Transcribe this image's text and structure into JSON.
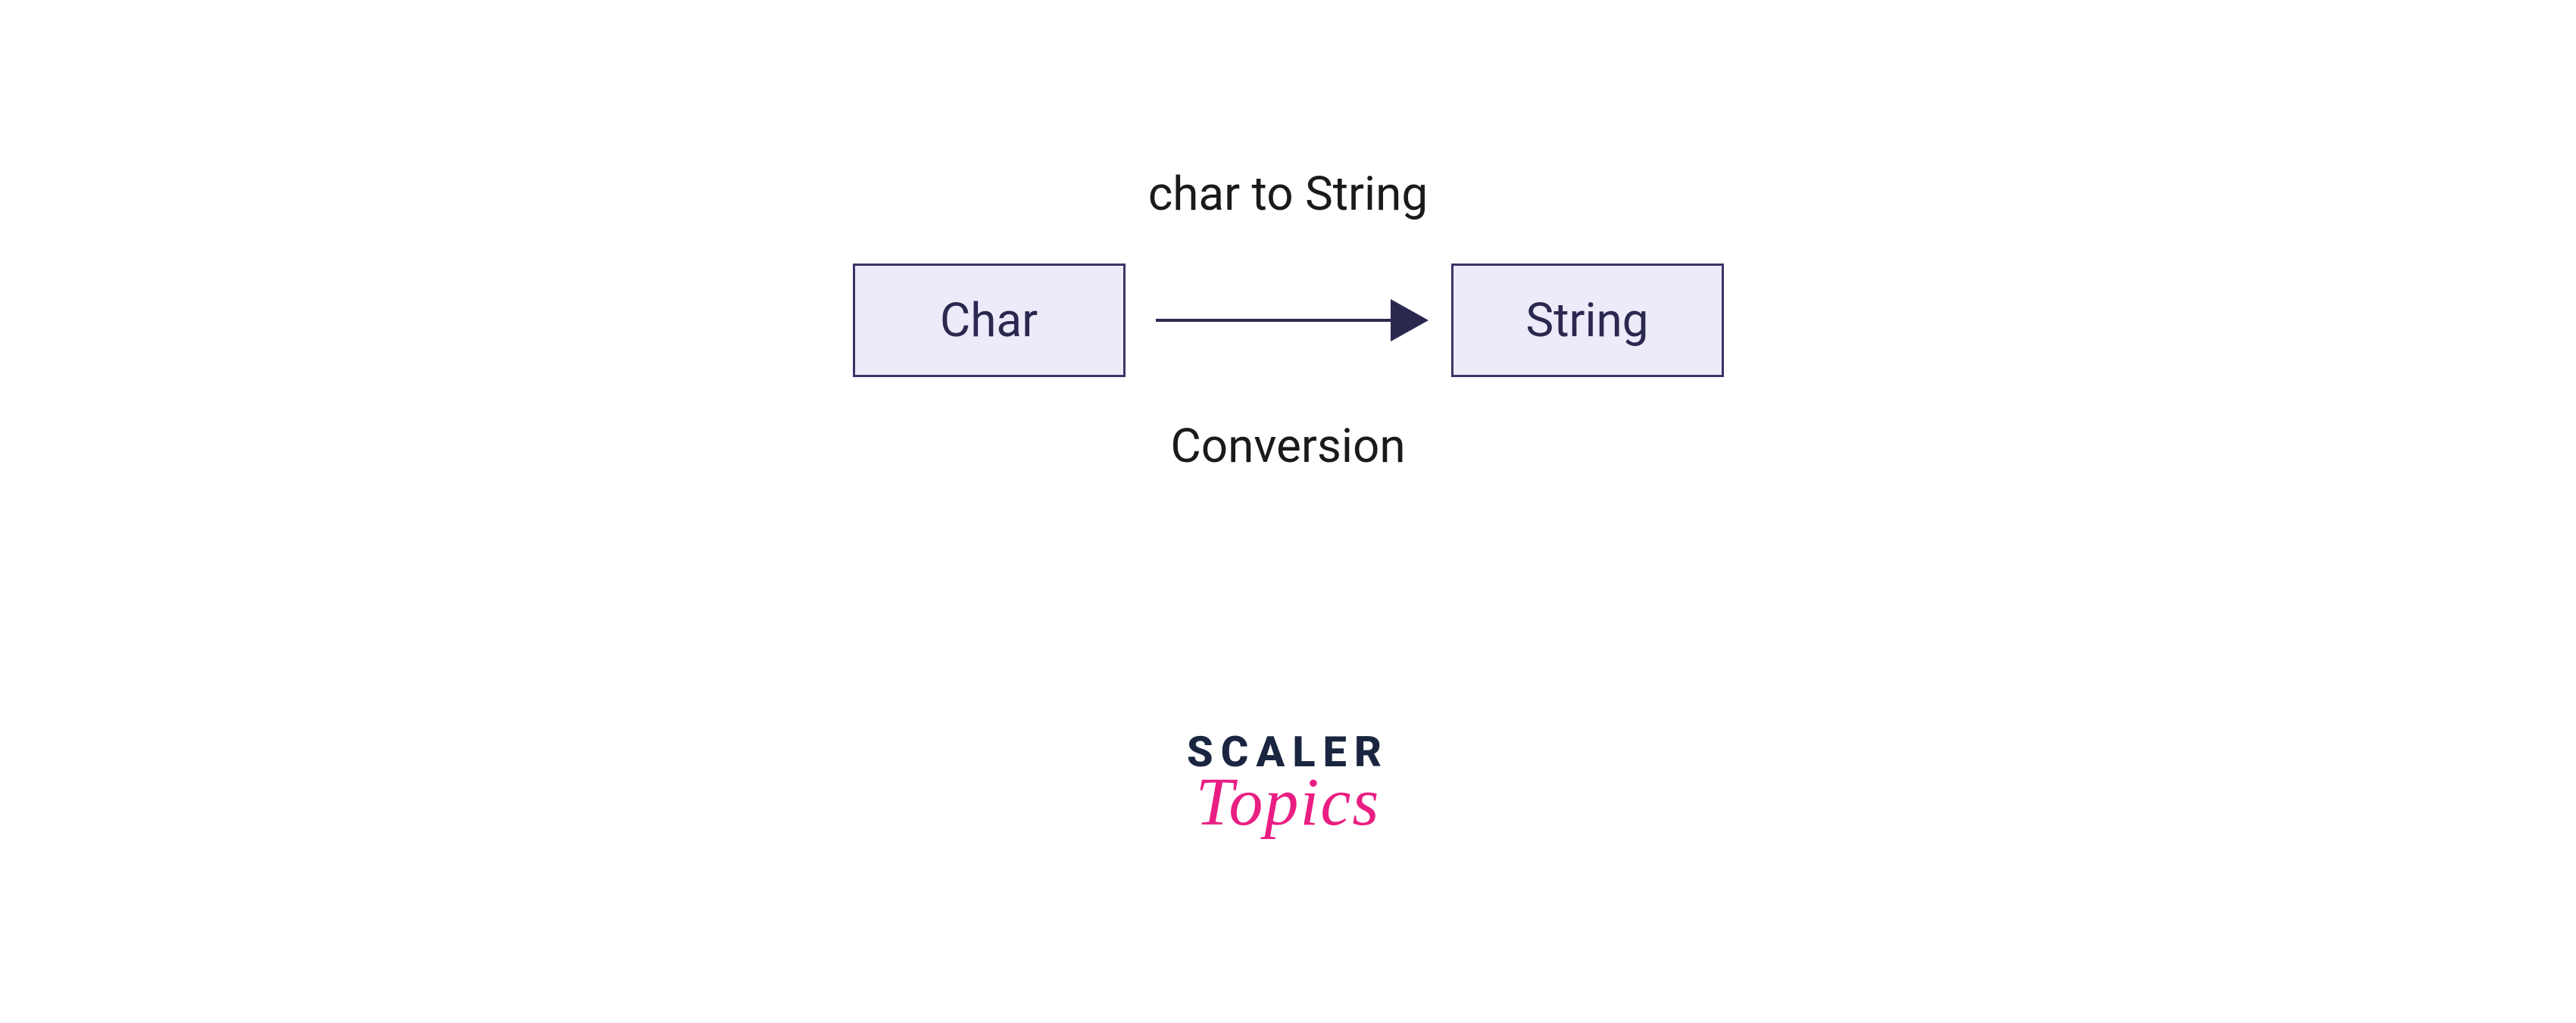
{
  "diagram": {
    "title": "char to String",
    "subtitle": "Conversion",
    "from_box": "Char",
    "to_box": "String"
  },
  "logo": {
    "line1": "SCALER",
    "line2": "Topics"
  }
}
